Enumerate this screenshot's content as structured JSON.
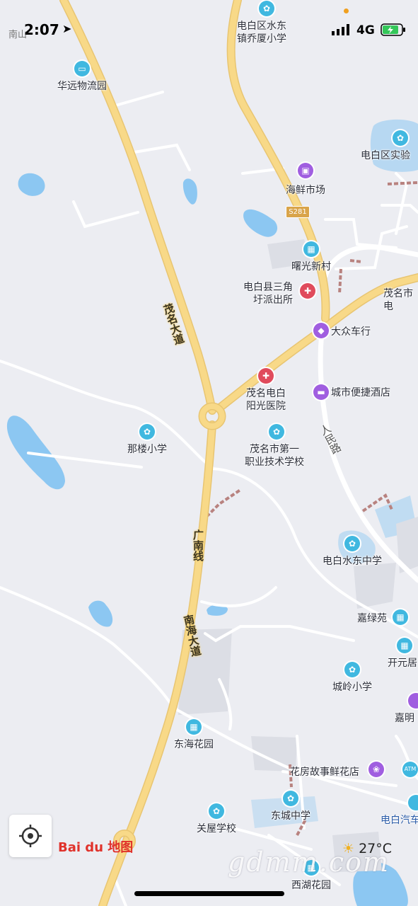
{
  "status_bar": {
    "time": "2:07",
    "carrier_hint": "南山",
    "network": "4G",
    "colors": {
      "battery": "#34c759"
    }
  },
  "map": {
    "route_shield": "S281",
    "roads": [
      {
        "id": "maoming-avenue",
        "label": "茂名大道"
      },
      {
        "id": "guangnan-line",
        "label": "广南线"
      },
      {
        "id": "nanhai-avenue",
        "label": "南海大道"
      },
      {
        "id": "renmin-road",
        "label": "人民路"
      }
    ],
    "pois": [
      {
        "id": "dianbai-shuidong-qiaoxia-school",
        "label": "电白区水东\n镇乔厦小学",
        "icon": "school-icon",
        "color": "#40b8e0"
      },
      {
        "id": "huayuan-logistics",
        "label": "华远物流园",
        "icon": "truck-icon",
        "color": "#40b8e0"
      },
      {
        "id": "dianbai-experimental",
        "label": "电白区实验",
        "icon": "school-icon",
        "color": "#40b8e0"
      },
      {
        "id": "seafood-market",
        "label": "海鲜市场",
        "icon": "shopping-bag-icon",
        "color": "#a05ee0"
      },
      {
        "id": "shuguang-village",
        "label": "曙光新村",
        "icon": "building-icon",
        "color": "#40b8e0"
      },
      {
        "id": "sanjiao-police",
        "label": "电白县三角\n圩派出所",
        "icon": "police-icon",
        "color": "#e04b5c"
      },
      {
        "id": "maoming-city-partial",
        "label": "茂名市\n电",
        "icon": "",
        "color": ""
      },
      {
        "id": "dazhong-car",
        "label": "大众车行",
        "icon": "car-dealer-icon",
        "color": "#a05ee0"
      },
      {
        "id": "yangguang-hospital",
        "label": "茂名电白\n阳光医院",
        "icon": "hospital-icon",
        "color": "#e04b5c"
      },
      {
        "id": "city-express-hotel",
        "label": "城市便捷酒店",
        "icon": "hotel-icon",
        "color": "#a05ee0"
      },
      {
        "id": "nalou-school",
        "label": "那楼小学",
        "icon": "school-icon",
        "color": "#40b8e0"
      },
      {
        "id": "maoming-vocational",
        "label": "茂名市第一\n职业技术学校",
        "icon": "school-icon",
        "color": "#40b8e0"
      },
      {
        "id": "shuidong-middle",
        "label": "电白水东中学",
        "icon": "school-icon",
        "color": "#40b8e0"
      },
      {
        "id": "jialvyuan",
        "label": "嘉绿苑",
        "icon": "building-icon",
        "color": "#40b8e0"
      },
      {
        "id": "kaiyuanju",
        "label": "开元居",
        "icon": "building-icon",
        "color": "#40b8e0"
      },
      {
        "id": "chengling-school",
        "label": "城岭小学",
        "icon": "school-icon",
        "color": "#40b8e0"
      },
      {
        "id": "jiaming",
        "label": "嘉明",
        "icon": "",
        "color": "#a05ee0"
      },
      {
        "id": "donghai-garden",
        "label": "东海花园",
        "icon": "building-icon",
        "color": "#40b8e0"
      },
      {
        "id": "flower-shop",
        "label": "花房故事鲜花店",
        "icon": "flower-shop-icon",
        "color": "#a05ee0"
      },
      {
        "id": "atm",
        "label": "ATM",
        "icon": "atm-icon",
        "color": "#40b8e0"
      },
      {
        "id": "dongcheng-middle",
        "label": "东城中学",
        "icon": "school-icon",
        "color": "#40b8e0"
      },
      {
        "id": "guanwu-school",
        "label": "关屋学校",
        "icon": "school-icon",
        "color": "#40b8e0"
      },
      {
        "id": "dianbai-bus",
        "label": "电白汽车",
        "icon": "bus-icon",
        "color": "#40b8e0"
      },
      {
        "id": "xihu-garden",
        "label": "西湖花园",
        "icon": "building-icon",
        "color": "#40b8e0"
      }
    ]
  },
  "controls": {
    "locate_icon": "locate-target-icon",
    "logo_text": "Bai du 地图",
    "weather": {
      "temp": "27°C",
      "icon": "sun-cloud-icon"
    },
    "watermark": "gdmm.com"
  }
}
